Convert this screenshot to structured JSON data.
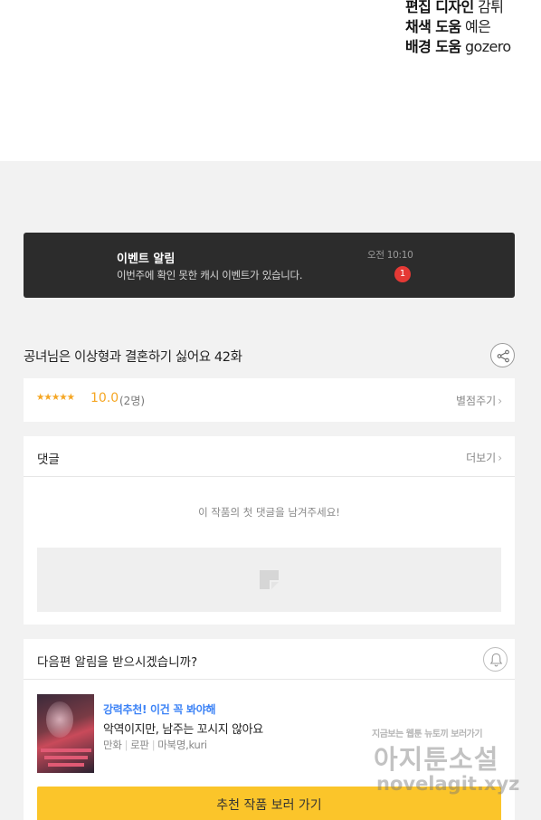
{
  "credits": {
    "line1": {
      "role": "편집 디자인",
      "name": "감튀"
    },
    "line2": {
      "role": "채색 도움",
      "name": "예은"
    },
    "line3": {
      "role": "배경 도움",
      "name": "gozero"
    }
  },
  "event": {
    "title": "이벤트 알림",
    "description": "이번주에 확인 못한 캐시 이벤트가 있습니다.",
    "time": "오전 10:10",
    "badge": "1"
  },
  "episode": {
    "title": "공녀님은 이상형과 결혼하기 싫어요 42화"
  },
  "rating": {
    "stars": "★★★★★",
    "score": "10.0",
    "count": "(2명)",
    "rate_link": "별점주기",
    "rate_level": 1.0
  },
  "comments": {
    "label": "댓글",
    "more": "더보기",
    "empty_message": "이 작품의 첫 댓글을 남겨주세요!"
  },
  "next_episode": {
    "label": "다음편 알림을 받으시겠습니까?"
  },
  "recommendation": {
    "tag": "강력추천! 이건 꼭 봐야해",
    "title": "악역이지만, 남주는 꼬시지 않아요",
    "genre": "만화",
    "type": "로판",
    "author": "마북명,kuri",
    "button": "추천 작품 보러 가기"
  },
  "watermark": {
    "tagline": "지금보는 웹툰 뉴토끼 보러가기",
    "brand": "아지툰소설",
    "url": "novelagit.xyz"
  },
  "colors": {
    "accent": "#fbc52a",
    "star": "#f5a623",
    "badge": "#e53935",
    "tag": "#3b82f6",
    "banner": "#2c2c2c"
  },
  "icons": [
    "share-icon",
    "bell-icon",
    "chevron-right-icon",
    "image-placeholder-icon"
  ]
}
